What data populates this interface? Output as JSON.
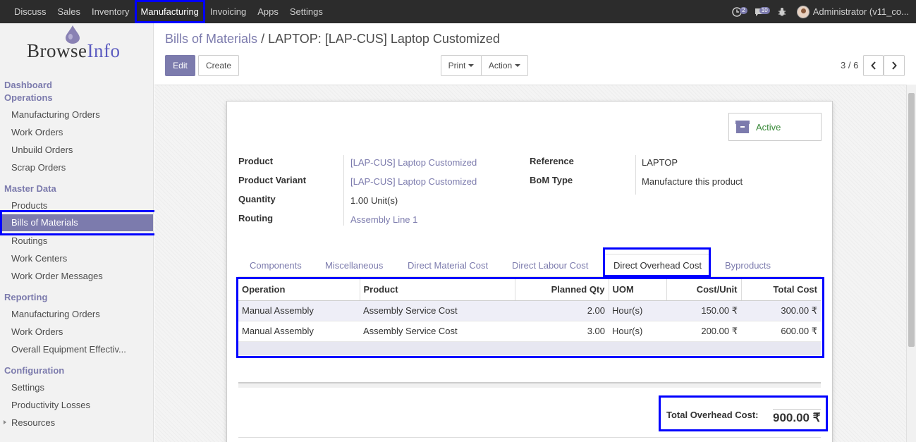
{
  "topbar": {
    "menu": [
      "Discuss",
      "Sales",
      "Inventory",
      "Manufacturing",
      "Invoicing",
      "Apps",
      "Settings"
    ],
    "active_menu": "Manufacturing",
    "activity_count": "2",
    "message_count": "10",
    "user": "Administrator (v11_co..."
  },
  "sidebar": {
    "logo_text_a": "Browse",
    "logo_text_b": "Info",
    "sections": [
      {
        "title": "Dashboard"
      },
      {
        "title": "Operations",
        "items": [
          "Manufacturing Orders",
          "Work Orders",
          "Unbuild Orders",
          "Scrap Orders"
        ]
      },
      {
        "title": "Master Data",
        "items": [
          "Products",
          "Bills of Materials",
          "Routings",
          "Work Centers",
          "Work Order Messages"
        ]
      },
      {
        "title": "Reporting",
        "items": [
          "Manufacturing Orders",
          "Work Orders",
          "Overall Equipment Effectiv..."
        ]
      },
      {
        "title": "Configuration",
        "items": [
          "Settings",
          "Productivity Losses",
          "Resources"
        ]
      }
    ]
  },
  "breadcrumb": {
    "parent": "Bills of Materials",
    "sep": "/",
    "current": "LAPTOP: [LAP-CUS] Laptop Customized"
  },
  "buttons": {
    "edit": "Edit",
    "create": "Create",
    "print": "Print",
    "action": "Action"
  },
  "pager": {
    "value": "3 / 6"
  },
  "form": {
    "status_button": "Active",
    "fields": {
      "product_label": "Product",
      "product_value": "[LAP-CUS] Laptop Customized",
      "variant_label": "Product Variant",
      "variant_value": "[LAP-CUS] Laptop Customized",
      "quantity_label": "Quantity",
      "quantity_value": "1.00",
      "quantity_uom": "Unit(s)",
      "routing_label": "Routing",
      "routing_value": "Assembly Line 1",
      "reference_label": "Reference",
      "reference_value": "LAPTOP",
      "bom_type_label": "BoM Type",
      "bom_type_value": "Manufacture this product"
    },
    "tabs": [
      "Components",
      "Miscellaneous",
      "Direct Material Cost",
      "Direct Labour Cost",
      "Direct Overhead Cost",
      "Byproducts"
    ],
    "active_tab": "Direct Overhead Cost",
    "table": {
      "columns": [
        "Operation",
        "Product",
        "Planned Qty",
        "UOM",
        "Cost/Unit",
        "Total Cost"
      ],
      "rows": [
        [
          "Manual Assembly",
          "Assembly Service Cost",
          "2.00",
          "Hour(s)",
          "150.00 ₹",
          "300.00 ₹"
        ],
        [
          "Manual Assembly",
          "Assembly Service Cost",
          "3.00",
          "Hour(s)",
          "200.00 ₹",
          "600.00 ₹"
        ]
      ]
    },
    "total_label": "Total Overhead Cost:",
    "total_value": "900.00 ₹"
  },
  "colors": {
    "accent": "#7c7bad",
    "highlight": "#0000ff",
    "navbar": "#2c2c2c"
  }
}
